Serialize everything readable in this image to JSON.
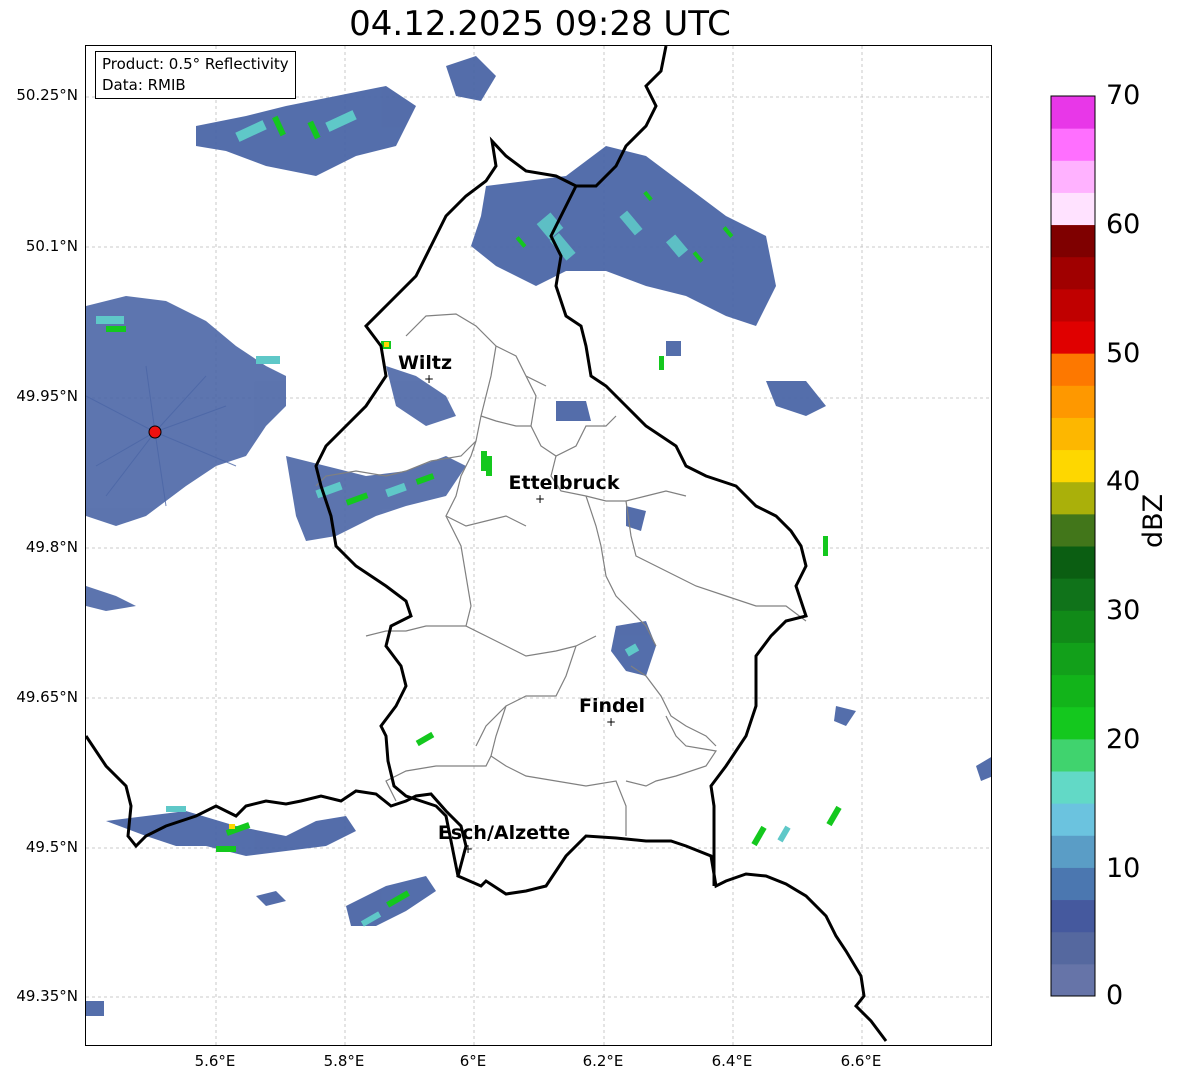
{
  "title": "04.12.2025 09:28 UTC",
  "info": {
    "product": "Product: 0.5° Reflectivity",
    "source": "Data: RMIB"
  },
  "lat_labels": [
    "50.25°N",
    "50.1°N",
    "49.95°N",
    "49.8°N",
    "49.65°N",
    "49.5°N",
    "49.35°N"
  ],
  "lon_labels": [
    "5.6°E",
    "5.8°E",
    "6°E",
    "6.2°E",
    "6.4°E",
    "6.6°E"
  ],
  "cities": [
    {
      "name": "Wiltz"
    },
    {
      "name": "Ettelbruck"
    },
    {
      "name": "Findel"
    },
    {
      "name": "Esch/Alzette"
    }
  ],
  "colorbar": {
    "title": "dBZ",
    "tick_labels": [
      "70",
      "60",
      "50",
      "40",
      "30",
      "20",
      "10",
      "0"
    ],
    "range": [
      0,
      70
    ],
    "colors": [
      "#6674a8",
      "#55689f",
      "#45599e",
      "#4b77b0",
      "#5a9dc6",
      "#6bc3df",
      "#62d9c6",
      "#40d36e",
      "#14c81e",
      "#12b41a",
      "#12a01a",
      "#118a18",
      "#10731a",
      "#0b5e12",
      "#42761a",
      "#aab00a",
      "#fed700",
      "#fdb700",
      "#fe9800",
      "#fd7800",
      "#e00000",
      "#c00000",
      "#a00000",
      "#7f0000",
      "#ffe2ff",
      "#ffb2ff",
      "#ff6fff",
      "#e837e8"
    ]
  },
  "radar_site_color": "#ee1111"
}
